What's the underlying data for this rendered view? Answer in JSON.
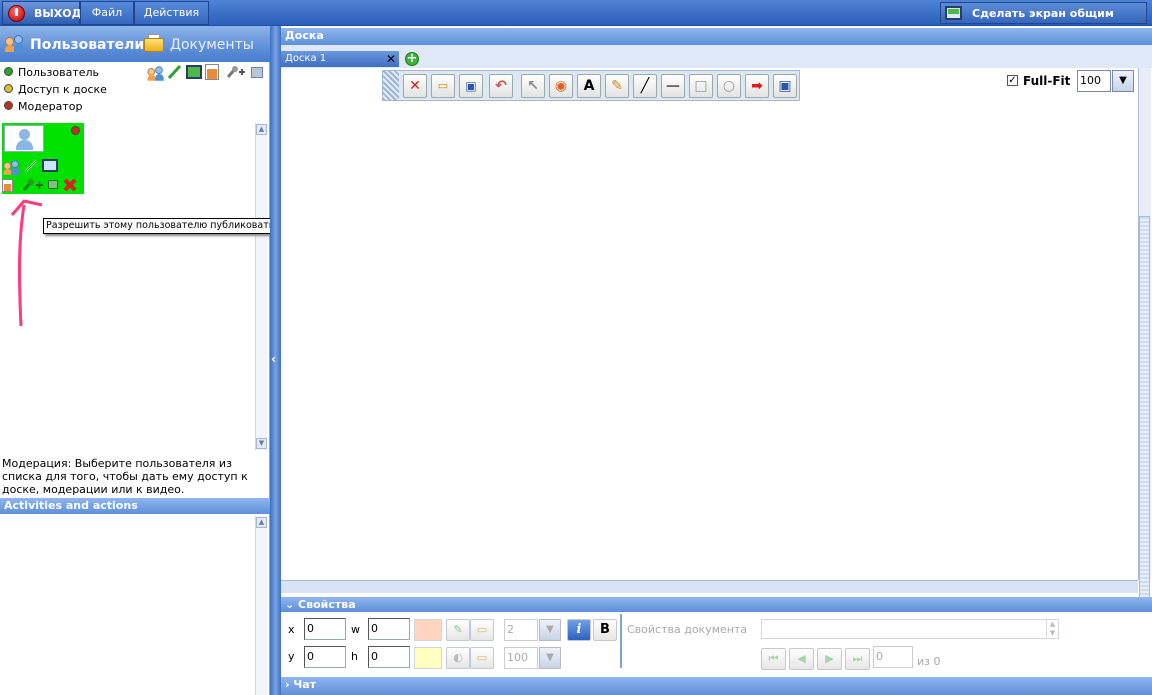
{
  "topbar": {
    "exit_label": "ВЫХОД",
    "menu": [
      "Файл",
      "Действия"
    ],
    "share_label": "Сделать экран общим"
  },
  "left": {
    "tab_users": "Пользователи",
    "tab_docs": "Документы",
    "legend": [
      "Пользователь",
      "Доступ к доске",
      "Модератор"
    ],
    "legend_colors": [
      "#2aa52a",
      "#d8c22e",
      "#c0302a"
    ],
    "tooltip": "Разрешить этому пользователю публиковать своё Аудио/Видео",
    "moderation_text": "Модерация: Выберите пользователя из списка для того, чтобы дать ему доступ к доске, модерации или к видео.",
    "activities_title": "Activities and actions"
  },
  "board": {
    "title": "Доска",
    "tab_label": "Доска 1",
    "fullfit_label": "Full-Fit",
    "zoom_value": "100"
  },
  "props": {
    "title": "Свойства",
    "x_label": "x",
    "x_value": "0",
    "y_label": "y",
    "y_value": "0",
    "w_label": "w",
    "w_value": "0",
    "h_label": "h",
    "h_value": "0",
    "line_width": "2",
    "opacity": "100",
    "italic": "i",
    "bold": "B",
    "doc_props_label": "Свойства документа",
    "page_value": "0",
    "page_of": "из 0"
  },
  "chat": {
    "title": "Чат"
  }
}
